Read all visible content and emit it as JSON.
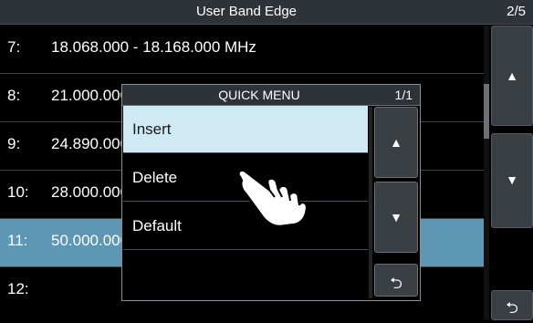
{
  "header": {
    "title": "User Band Edge",
    "page": "2/5"
  },
  "rows": [
    {
      "num": "7:",
      "value": "18.068.000 - 18.168.000 MHz"
    },
    {
      "num": "8:",
      "value": "21.000.000"
    },
    {
      "num": "9:",
      "value": "24.890.000"
    },
    {
      "num": "10:",
      "value": "28.000.000"
    },
    {
      "num": "11:",
      "value": "50.000.000"
    },
    {
      "num": "12:",
      "value": ""
    }
  ],
  "side_buttons": {
    "up": "▲",
    "down": "▼",
    "back": "⮌"
  },
  "quick_menu": {
    "title": "QUICK MENU",
    "page": "1/1",
    "items": [
      {
        "label": "Insert"
      },
      {
        "label": "Delete"
      },
      {
        "label": "Default"
      }
    ],
    "up": "▲",
    "down": "▼",
    "back": "⮌"
  },
  "colors": {
    "selected_row": "#5e96b5",
    "highlighted_item": "#cfeaf5",
    "title_bar": "#2e3338"
  },
  "icons": {
    "pointer": "hand-pointer-icon"
  }
}
